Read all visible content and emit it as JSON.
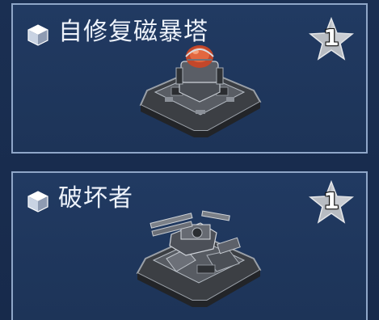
{
  "cards": [
    {
      "title": "自修复磁暴塔",
      "level": "1",
      "icon": "cube-icon",
      "image": "tesla-tower-building"
    },
    {
      "title": "破坏者",
      "level": "1",
      "icon": "cube-icon",
      "image": "destroyer-turret-building"
    }
  ],
  "colors": {
    "background": "#172a4b",
    "card_border": "#8fa6c8",
    "star": "#b8bcc2",
    "text": "#eef3fb"
  }
}
